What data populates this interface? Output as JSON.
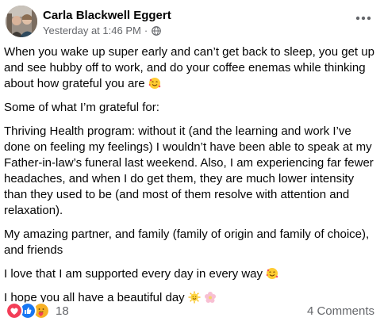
{
  "post": {
    "author": "Carla Blackwell Eggert",
    "timestamp": "Yesterday at 1:46 PM",
    "separator": "·",
    "audience_icon": "globe-icon",
    "more_icon": "more-options-icon",
    "paragraphs": [
      {
        "text": "When you wake up super early and can’t get back to sleep, you get up and see hubby off to work, and do your coffee enemas while thinking about how grateful you are",
        "emoji": "smiling-face-with-hearts-icon"
      },
      {
        "text": "Some of what I’m grateful for:",
        "emoji": ""
      },
      {
        "text": "Thriving Health program: without it (and the learning and work I’ve done on feeling my feelings) I wouldn’t have been able to speak at my Father-in-law’s funeral last weekend. Also, I am experiencing far fewer headaches, and when I do get them, they are much lower intensity than they used to be (and most of them resolve with attention and relaxation).",
        "emoji": ""
      },
      {
        "text": "My amazing partner, and family (family of origin and family of choice), and friends",
        "emoji": ""
      },
      {
        "text": "I love that I am supported every day in every way",
        "emoji": "smiling-face-with-hearts-icon"
      },
      {
        "text": "I hope you all have a beautiful day",
        "emoji": "sun-with-face-icon, blossom-icon"
      }
    ]
  },
  "footer": {
    "reactions": [
      "love-reaction-icon",
      "like-reaction-icon",
      "care-reaction-icon"
    ],
    "reaction_count": "18",
    "comments": "4 Comments"
  },
  "colors": {
    "text": "#050505",
    "secondary": "#65676b",
    "like": "#1877f2",
    "love": "#f33e58",
    "care": "#f7b125"
  }
}
